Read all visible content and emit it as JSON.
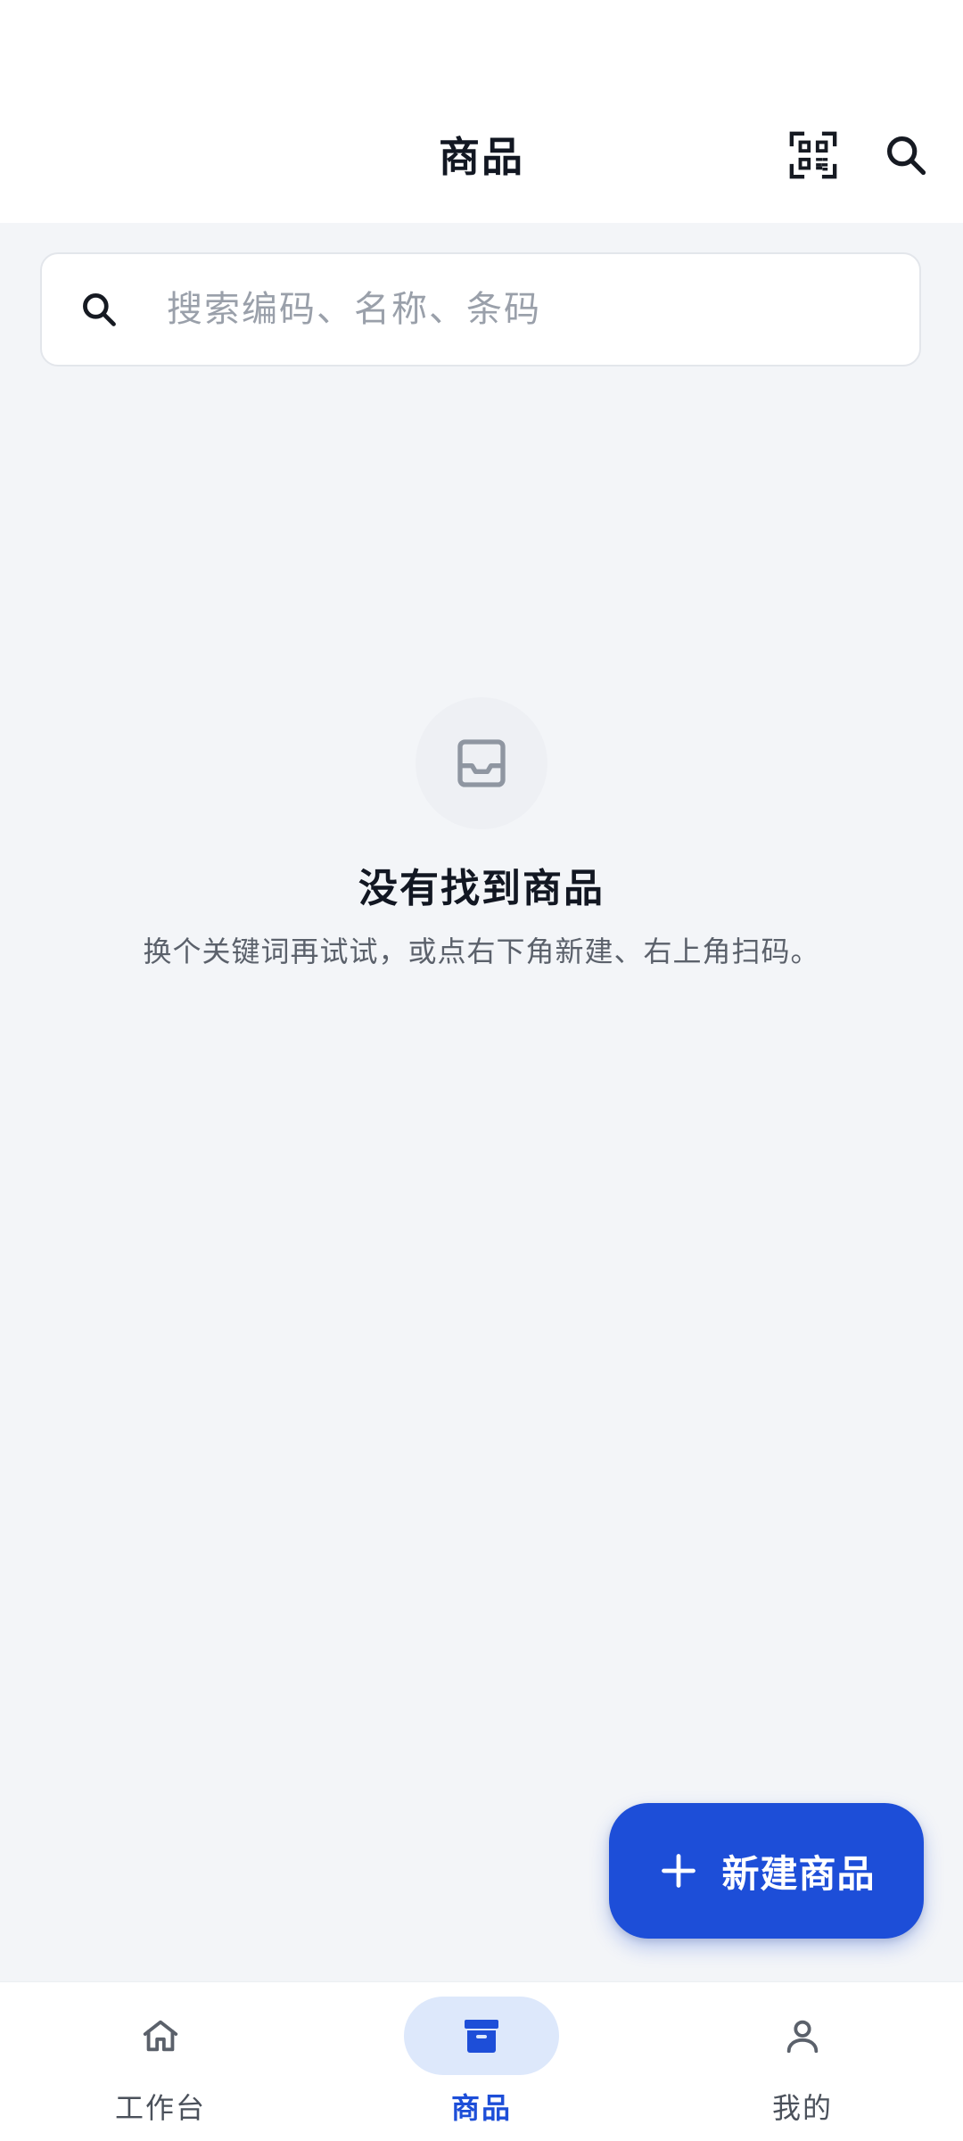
{
  "header": {
    "title": "商品",
    "scan_icon": "qr-scan-icon",
    "search_icon": "search-icon"
  },
  "search": {
    "placeholder": "搜索编码、名称、条码",
    "value": ""
  },
  "empty_state": {
    "icon": "inbox-icon",
    "title": "没有找到商品",
    "subtitle": "换个关键词再试试，或点右下角新建、右上角扫码。"
  },
  "fab": {
    "label": "新建商品",
    "icon": "plus-icon"
  },
  "bottom_nav": {
    "items": [
      {
        "label": "工作台",
        "icon": "home-icon",
        "active": false
      },
      {
        "label": "商品",
        "icon": "archive-box-icon",
        "active": true
      },
      {
        "label": "我的",
        "icon": "user-icon",
        "active": false
      }
    ]
  },
  "colors": {
    "accent": "#1d4ed8",
    "accent_soft": "#dde8fb",
    "background": "#f3f5f8",
    "surface": "#ffffff"
  }
}
